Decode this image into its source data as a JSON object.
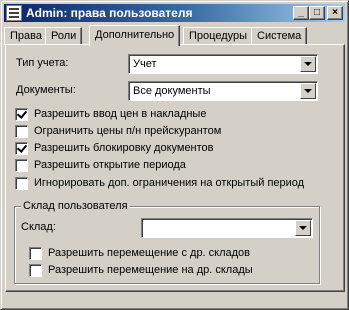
{
  "window": {
    "title": "Admin: права пользователя",
    "icon": "app-grid-icon",
    "controls": {
      "minimize": "_",
      "maximize": "□",
      "close": "×"
    }
  },
  "tabs": [
    {
      "label": "Права",
      "active": false
    },
    {
      "label": "Роли",
      "active": false
    },
    {
      "label": "Дополнительно",
      "active": true
    },
    {
      "label": "Процедуры",
      "active": false
    },
    {
      "label": "Система",
      "active": false
    }
  ],
  "form": {
    "account_type": {
      "label": "Тип учета:",
      "value": "Учет"
    },
    "documents": {
      "label": "Документы:",
      "value": "Все документы"
    },
    "options": [
      {
        "label": "Разрешить ввод цен в накладные",
        "checked": true
      },
      {
        "label": "Ограничить цены п/н прейскурантом",
        "checked": false
      },
      {
        "label": "Разрешить блокировку документов",
        "checked": true
      },
      {
        "label": "Разрешить открытие периода",
        "checked": false
      },
      {
        "label": "Игнорировать доп. ограничения на открытый период",
        "checked": false
      }
    ],
    "warehouse_group": {
      "title": "Склад пользователя",
      "warehouse": {
        "label": "Склад:",
        "value": ""
      },
      "options": [
        {
          "label": "Разрешить перемещение с др. складов",
          "checked": false
        },
        {
          "label": "Разрешить перемещение на др. склады",
          "checked": false
        }
      ]
    }
  }
}
